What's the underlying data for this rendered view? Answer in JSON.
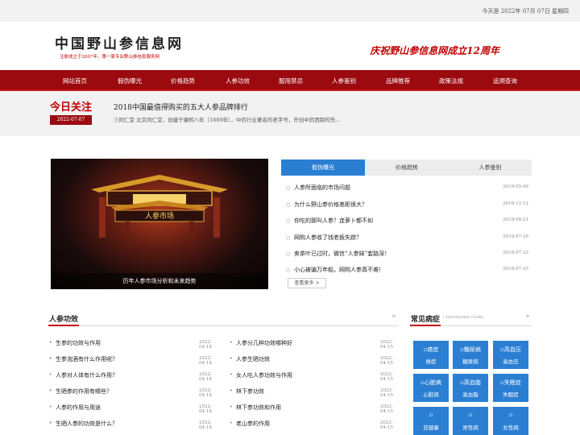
{
  "topbar": {
    "date": "今天是 2022年 07月 07日 星期四"
  },
  "logo": {
    "name": "中国野山参信息网",
    "tagline": "注册成立于2007年，第一家专业野山参信息服务网"
  },
  "slogan": "庆祝野山参信息网成立12周年",
  "nav": [
    "网站首页",
    "假伪曝光",
    "价格趋势",
    "人参功效",
    "服用禁忌",
    "人参鉴别",
    "品牌推荐",
    "政策法规",
    "追溯查询"
  ],
  "today": {
    "title": "今日关注",
    "date": "2022-07-07",
    "headline": "2018中国最值得购买的五大人参品牌排行",
    "summary": "①同仁堂 北京同仁堂，创建于康熙八年（1669年），中药行业著名的老字号，开创中药西制的先..."
  },
  "photo": {
    "caption": "历年人参市场分析和未来趋势",
    "sign": "人参市场"
  },
  "tabs": [
    "假伪曝光",
    "价格趋势",
    "人参鉴别"
  ],
  "news": [
    {
      "title": "人参所面临的市场问题",
      "date": "2019-05-06"
    },
    {
      "title": "为什么野山参价格差距很大？",
      "date": "2018-12-12"
    },
    {
      "title": "你吃的那叫人参？连萝卜都不如",
      "date": "2018-08-21"
    },
    {
      "title": "网购人参收了钱老板失踪？",
      "date": "2018-07-26"
    },
    {
      "title": "卖茶叶已过时，微信“人参妹”套路深！",
      "date": "2018-07-25"
    },
    {
      "title": "小心被骗万年船，网购人参真不难！",
      "date": "2018-07-25"
    }
  ],
  "more": "查看更多 >",
  "section_left": {
    "title": "人参功效",
    "arrow": "»"
  },
  "col1": [
    {
      "title": "生参的功效与作用",
      "date": "2022-04-18"
    },
    {
      "title": "生参泡酒有什么作用呢?",
      "date": "2022-04-18"
    },
    {
      "title": "人参对人体有什么作用?",
      "date": "2022-04-18"
    },
    {
      "title": "生晒参的作用有哪些?",
      "date": "2022-04-18"
    },
    {
      "title": "人参的作用与用途",
      "date": "2022-04-18"
    },
    {
      "title": "生晒人参的功效是什么？",
      "date": "2022-04-18"
    }
  ],
  "col2": [
    {
      "title": "人参分几种功效哪种好",
      "date": "2022-04-15"
    },
    {
      "title": "人参生晒功效",
      "date": "2022-04-15"
    },
    {
      "title": "女人吃人参功效与作用",
      "date": "2022-04-15"
    },
    {
      "title": "林下参功效",
      "date": "2022-04-15"
    },
    {
      "title": "林下参功效和作用",
      "date": "2022-04-15"
    },
    {
      "title": "老山参的作用",
      "date": "2022-04-15"
    }
  ],
  "section_right": {
    "title": "常见病症",
    "guide": "/ Information Guide",
    "arrow": "»"
  },
  "diseases": [
    {
      "icon": "癌症",
      "label": "癌症"
    },
    {
      "icon": "糖尿病",
      "label": "糖尿病"
    },
    {
      "icon": "高血压",
      "label": "高血压"
    },
    {
      "icon": "心脏病",
      "label": "心脏病"
    },
    {
      "icon": "高血脂",
      "label": "高血脂"
    },
    {
      "icon": "失眠症",
      "label": "失眠症"
    },
    {
      "icon": "",
      "label": "亚健康"
    },
    {
      "icon": "",
      "label": "男性病"
    },
    {
      "icon": "",
      "label": "女性病"
    }
  ],
  "colors": {
    "brand_red": "#9b0a0f",
    "accent_blue": "#2b7fd3"
  }
}
